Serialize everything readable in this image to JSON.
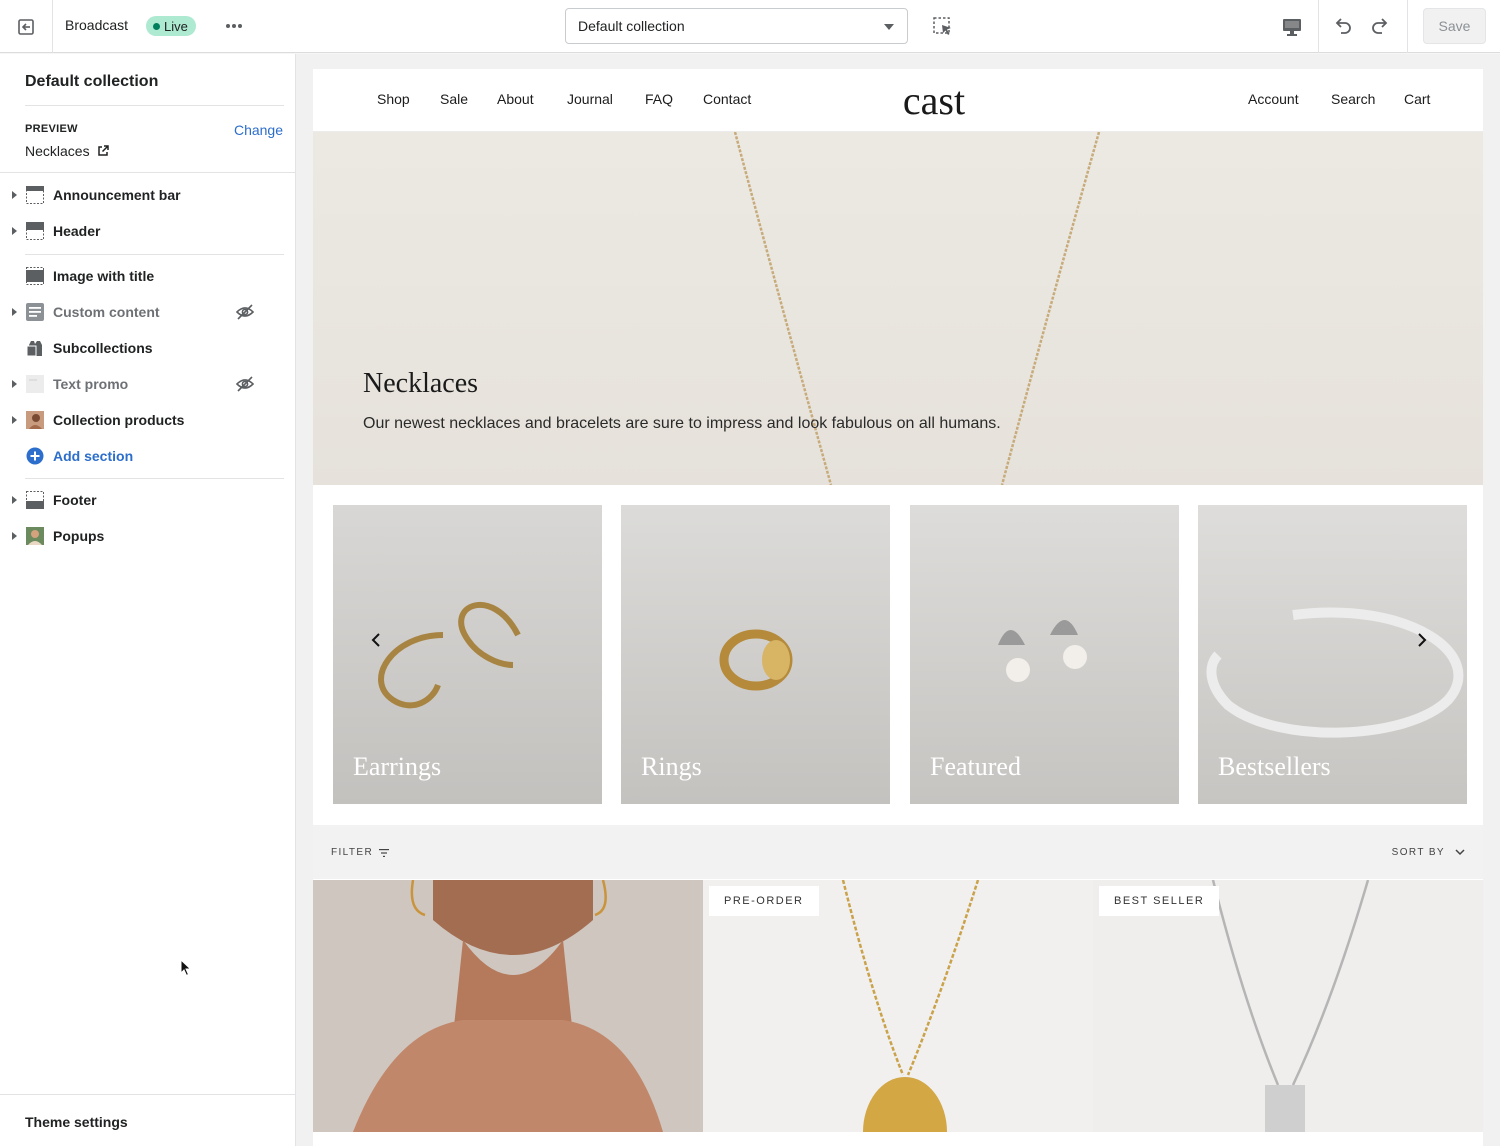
{
  "topbar": {
    "theme_name": "Broadcast",
    "status": "Live",
    "template_select": "Default collection",
    "save_label": "Save"
  },
  "sidebar": {
    "title": "Default collection",
    "preview_label": "PREVIEW",
    "change_label": "Change",
    "preview_value": "Necklaces",
    "sections": [
      {
        "label": "Announcement bar",
        "icon": "section-layout-icon"
      },
      {
        "label": "Header",
        "icon": "header-layout-icon"
      },
      {
        "label": "Image with title",
        "icon": "section-layout-icon"
      },
      {
        "label": "Custom content",
        "icon": "text-block-icon",
        "hidden": true
      },
      {
        "label": "Subcollections",
        "icon": "bag-icon"
      },
      {
        "label": "Text promo",
        "icon": "image-thumbnail-icon",
        "hidden": true
      },
      {
        "label": "Collection products",
        "icon": "product-thumbnail-icon"
      },
      {
        "label": "Add section",
        "icon": "plus-circle-icon"
      },
      {
        "label": "Footer",
        "icon": "section-layout-icon"
      },
      {
        "label": "Popups",
        "icon": "person-thumbnail-icon"
      }
    ],
    "theme_settings": "Theme settings"
  },
  "store": {
    "nav_left": [
      "Shop",
      "Sale",
      "About",
      "Journal",
      "FAQ",
      "Contact"
    ],
    "logo": "cast",
    "nav_right": [
      "Account",
      "Search",
      "Cart"
    ],
    "hero": {
      "title": "Necklaces",
      "description": "Our newest necklaces and bracelets are sure to impress and look fabulous on all humans."
    },
    "categories": [
      "Earrings",
      "Rings",
      "Featured",
      "Bestsellers"
    ],
    "filter_label": "FILTER",
    "sort_label": "SORT BY",
    "product_badges": [
      "PRE-ORDER",
      "BEST SELLER"
    ]
  },
  "colors": {
    "accent": "#2c6ecb",
    "live_badge": "#aee9d1",
    "live_dot": "#007f5f"
  }
}
